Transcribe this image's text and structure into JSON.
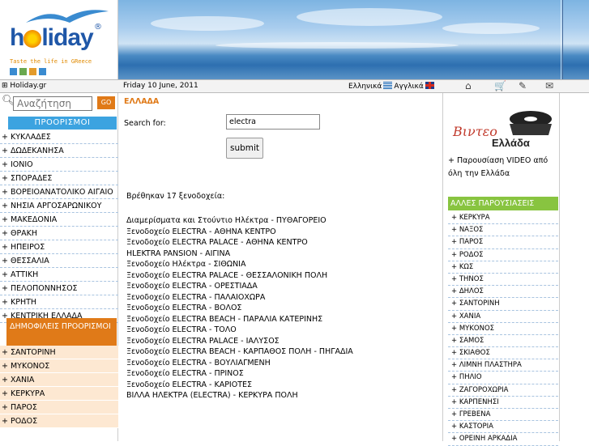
{
  "logo": {
    "text": "h",
    "text_rest": "liday",
    "reg": "®",
    "tagline": "Taste the life in GReece"
  },
  "topbar": {
    "home": "Holiday.gr",
    "date": "Friday 10 June, 2011",
    "lang_gr": "Ελληνικά",
    "lang_en": "Αγγλικά",
    "icons": [
      "home-icon",
      "cart-icon",
      "bookmark-icon",
      "mail-icon"
    ]
  },
  "search": {
    "placeholder": "Αναζήτηση",
    "go": "GO"
  },
  "destinations": {
    "heading": "ΠΡΟΟΡΙΣΜΟΙ",
    "items": [
      "+ ΚΥΚΛΑΔΕΣ",
      "+ ΔΩΔΕΚΑΝΗΣΑ",
      "+ ΙΟΝΙΟ",
      "+ ΣΠΟΡΑΔΕΣ",
      "+ ΒΟΡΕΙΟΑΝΑΤΟΛΙΚΟ ΑΙΓΑΙΟ",
      "+ ΝΗΣΙΑ ΑΡΓΟΣΑΡΩΝΙΚΟΥ",
      "+ ΜΑΚΕΔΟΝΙΑ",
      "+ ΘΡΑΚΗ",
      "+ ΗΠΕΙΡΟΣ",
      "+ ΘΕΣΣΑΛΙΑ",
      "+ ΑΤΤΙΚΗ",
      "+ ΠΕΛΟΠΟΝΝΗΣΟΣ",
      "+ ΚΡΗΤΗ",
      "+ ΚΕΝΤΡΙΚΗ ΕΛΛΑΔΑ"
    ]
  },
  "popular": {
    "heading": "ΔΗΜΟΦΙΛΕΙΣ ΠΡΟΟΡΙΣΜΟΙ",
    "items": [
      "+ ΣΑΝΤΟΡΙΝΗ",
      "+ ΜΥΚΟΝΟΣ",
      "+ ΧΑΝΙΑ",
      "+ ΚΕΡΚΥΡΑ",
      "+ ΠΑΡΟΣ",
      "+ ΡΟΔΟΣ"
    ]
  },
  "main": {
    "breadcrumb": "ΕΛΛΑΔΑ",
    "search_label": "Search for:",
    "search_value": "electra",
    "submit": "submit",
    "found": "Βρέθηκαν 17 ξενοδοχεία:",
    "results": [
      "Διαμερίσματα και Στούντιο Ηλέκτρα - ΠΥΘΑΓΟΡΕΙΟ",
      "Ξενοδοχείο ELECTRA - ΑΘΗΝΑ ΚΕΝΤΡΟ",
      "Ξενοδοχείο ELECTRA PALACE - ΑΘΗΝΑ ΚΕΝΤΡΟ",
      "HLEKTRA PANSION - ΑΙΓΙΝΑ",
      "Ξενοδοχείο Ηλέκτρα - ΣΙΘΩΝΙΑ",
      "Ξενοδοχείο ELECTRA PALACE - ΘΕΣΣΑΛΟΝΙΚΗ ΠΟΛΗ",
      "Ξενοδοχείο ELECTRA - ΟΡΕΣΤΙΑΔΑ",
      "Ξενοδοχείο ELECTRA - ΠΑΛΑΙΟΧΩΡΑ",
      "Ξενοδοχείο ELECTRA - ΒΟΛΟΣ",
      "Ξενοδοχείο ELECTRA BEACH - ΠΑΡΑΛΙΑ ΚΑΤΕΡΙΝΗΣ",
      "Ξενοδοχείο ELECTRA - ΤΟΛΟ",
      "Ξενοδοχείο ELECTRA PALACE - ΙΑΛΥΣΟΣ",
      "Ξενοδοχείο ELECTRA BEACH - ΚΑΡΠΑΘΟΣ ΠΟΛΗ - ΠΗΓΑΔΙΑ",
      "Ξενοδοχείο ELECTRA - ΒΟΥΛΙΑΓΜΕΝΗ",
      "Ξενοδοχείο ELECTRA - ΠΡΙΝΟΣ",
      "Ξενοδοχείο ELECTRA - ΚΑΡΙΟΤΕΣ",
      "ΒΙΛΛΑ ΗΛΕΚΤΡΑ (ELECTRA) - ΚΕΡΚΥΡΑ ΠΟΛΗ"
    ]
  },
  "right": {
    "video_script": "Βιντεο",
    "video_ellada": "Ελλάδα",
    "video_text": "+ Παρουσίαση VIDEO από όλη την Ελλάδα",
    "other_heading": "ΑΛΛΕΣ ΠΑΡΟΥΣΙΑΣΕΙΣ",
    "other_items": [
      "+ ΚΕΡΚΥΡΑ",
      "+ ΝΑΞΟΣ",
      "+ ΠΑΡΟΣ",
      "+ ΡΟΔΟΣ",
      "+ ΚΩΣ",
      "+ ΤΗΝΟΣ",
      "+ ΔΗΛΟΣ",
      "+ ΣΑΝΤΟΡΙΝΗ",
      "+ ΧΑΝΙΑ",
      "+ ΜΥΚΟΝΟΣ",
      "+ ΣΑΜΟΣ",
      "+ ΣΚΙΑΘΟΣ",
      "+ ΛΙΜΝΗ ΠΛΑΣΤΗΡΑ",
      "+ ΠΗΛΙΟ",
      "+ ΖΑΓΟΡΟΧΩΡΙΑ",
      "+ ΚΑΡΠΕΝΗΣΙ",
      "+ ΓΡΕΒΕΝΑ",
      "+ ΚΑΣΤΟΡΙΑ",
      "+ ΟΡΕΙΝΗ ΑΡΚΑΔΙΑ"
    ]
  },
  "colors": {
    "accent_orange": "#e07a18",
    "accent_blue": "#3ca3e0",
    "accent_green": "#88c440"
  }
}
